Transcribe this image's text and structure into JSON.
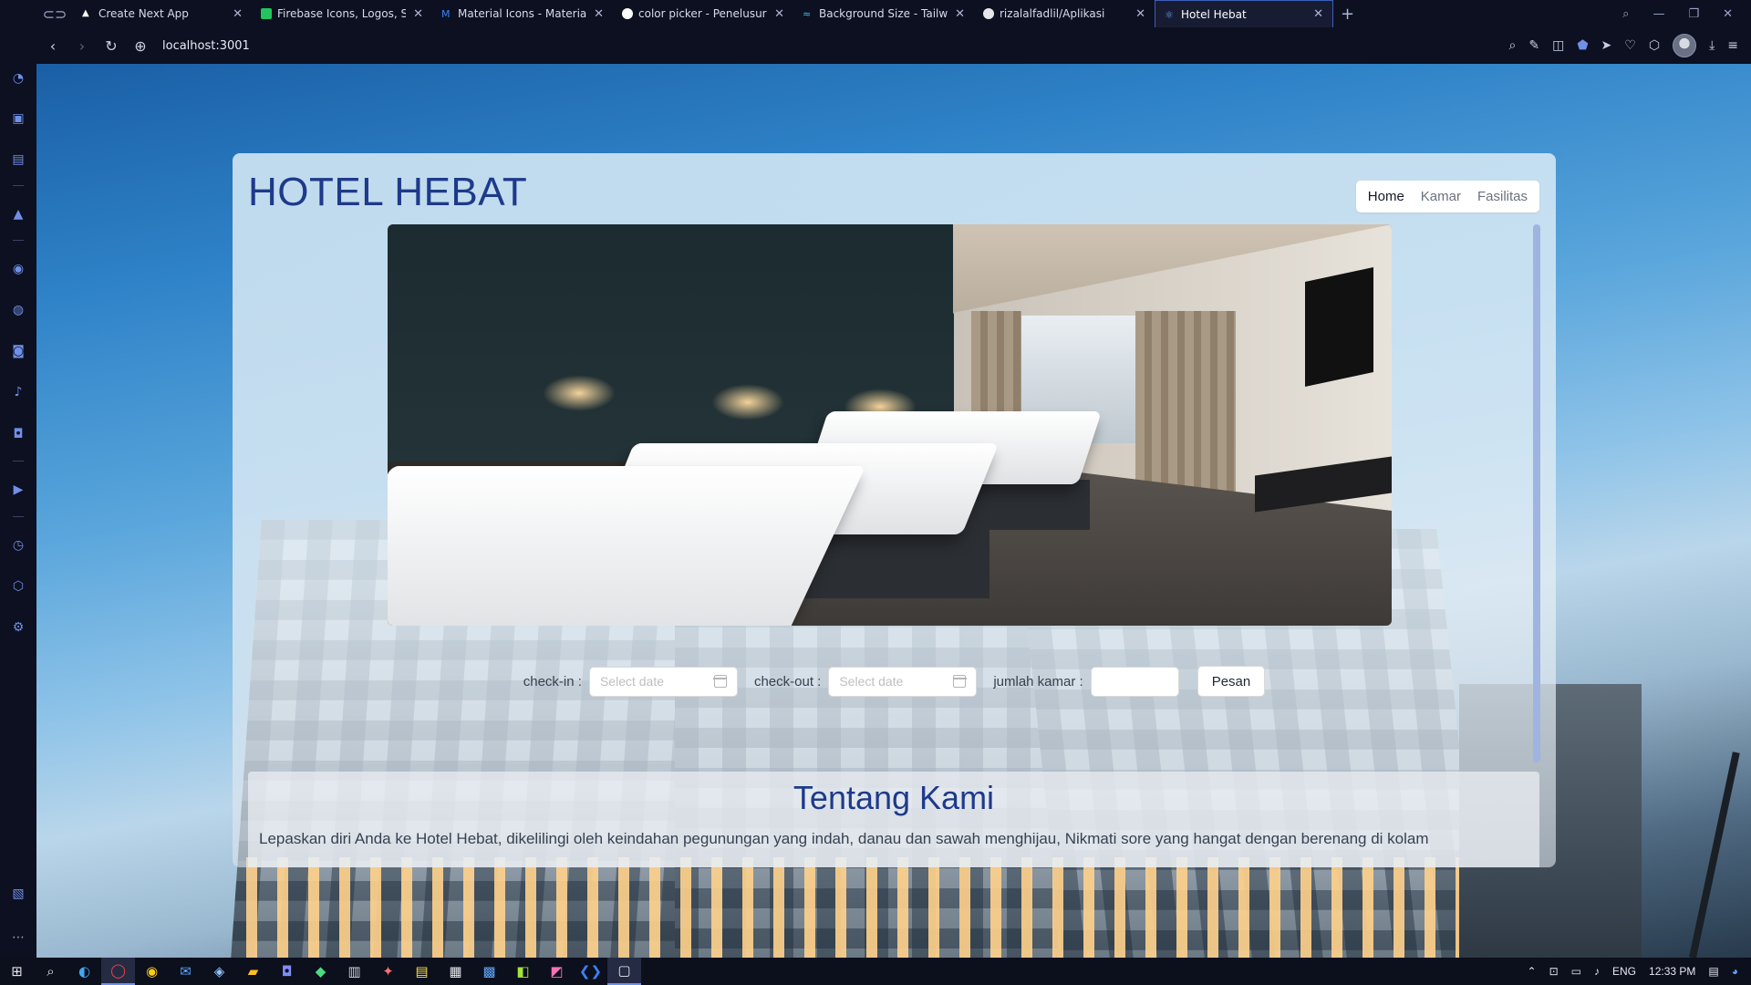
{
  "browser": {
    "tabs": [
      {
        "title": "Create Next App",
        "favicon_color": "#ffffff"
      },
      {
        "title": "Firebase Icons, Logos, Symb",
        "favicon_color": "#4ade80"
      },
      {
        "title": "Material Icons - Material UI",
        "favicon_color": "#3b82f6"
      },
      {
        "title": "color picker - Penelusuran",
        "favicon_color": "#ffffff"
      },
      {
        "title": "Background Size - Tailwind",
        "favicon_color": "#38bdf8"
      },
      {
        "title": "rizalalfadlil/Aplikasi",
        "favicon_color": "#e5e7eb"
      },
      {
        "title": "Hotel Hebat",
        "favicon_color": "#60a5fa"
      }
    ],
    "active_tab_index": 6,
    "url": "localhost:3001"
  },
  "page": {
    "brand": "HOTEL HEBAT",
    "nav": [
      {
        "label": "Home",
        "active": true
      },
      {
        "label": "Kamar",
        "active": false
      },
      {
        "label": "Fasilitas",
        "active": false
      }
    ],
    "booking": {
      "checkin_label": "check-in :",
      "checkin_placeholder": "Select date",
      "checkout_label": "check-out :",
      "checkout_placeholder": "Select date",
      "rooms_label": "jumlah kamar :",
      "rooms_value": "",
      "submit_label": "Pesan"
    },
    "about": {
      "title": "Tentang Kami",
      "text": "Lepaskan diri Anda ke Hotel Hebat, dikelilingi oleh keindahan pegunungan yang indah, danau dan sawah menghijau, Nikmati sore yang hangat dengan berenang di kolam"
    }
  },
  "taskbar": {
    "language": "ENG",
    "time": "12:33 PM"
  },
  "colors": {
    "brand_blue": "#1e3a8a",
    "accent": "#6f8fe8"
  }
}
